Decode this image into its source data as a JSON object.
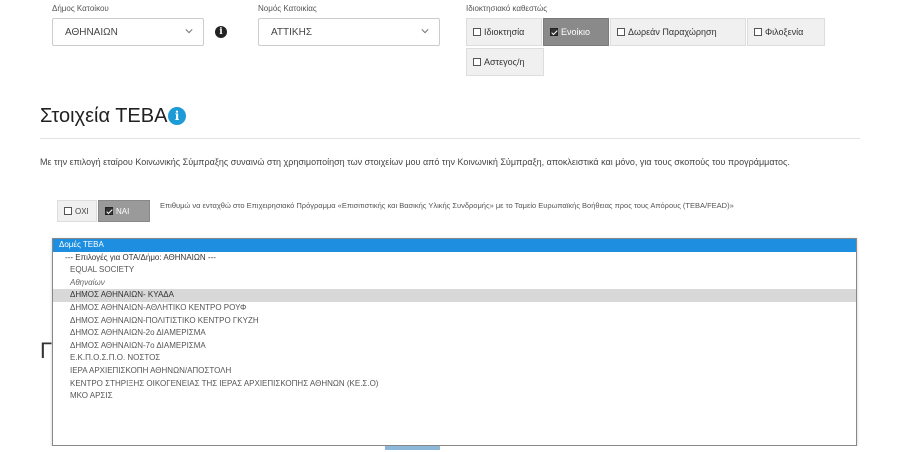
{
  "filters": {
    "municipality_label": "Δήμος Κατοίκου",
    "municipality_value": "ΑΘΗΝΑΙΩΝ",
    "region_label": "Νομός Κατοικίας",
    "region_value": "ΑΤΤΙΚΗΣ",
    "status_label": "Ιδιοκτησιακό καθεστώς",
    "status_options": [
      {
        "label": "Ιδιοκτησία",
        "checked": false
      },
      {
        "label": "Ενοίκιο",
        "checked": true
      },
      {
        "label": "Δωρεάν Παραχώρηση",
        "checked": false
      },
      {
        "label": "Φιλοξενία",
        "checked": false
      },
      {
        "label": "Αστεγος/η",
        "checked": false
      }
    ]
  },
  "teba": {
    "title": "Στοιχεία ΤΕΒΑ",
    "description": "Με την επιλογή εταίρου Κοινωνικής Σύμπραξης συναινώ στη χρησιμοποίηση των στοιχείων μου από την Κοινωνική Σύμπραξη, αποκλειστικά και μόνο, για τους σκοπούς του προγράμματος.",
    "toggle_no": "ΟΧΙ",
    "toggle_yes": "ΝΑΙ",
    "note": "Επιθυμώ να ενταχθώ στο Επιχειρησιακό Πρόγραμμα «Επισιτιστικής και Βασικής Υλικής Συνδρομής» με το Ταμείο Ευρωπαϊκής Βοήθειας προς τους Απόρους (ΤΕΒΑ/FEAD)»"
  },
  "background": {
    "partial_letter": "Γ"
  },
  "dropdown": {
    "items": [
      {
        "text": "Δομές ΤΕΒΑ",
        "kind": "selected"
      },
      {
        "text": "--- Επιλογές για ΟΤΑ/Δήμο: ΑΘΗΝΑΙΩΝ ---",
        "kind": "group"
      },
      {
        "text": "EQUAL SOCIETY",
        "kind": "normal"
      },
      {
        "text": "Αθηναίων",
        "kind": "italic"
      },
      {
        "text": "ΔΗΜΟΣ ΑΘΗΝΑΙΩΝ- ΚΥΑΔΑ",
        "kind": "hover"
      },
      {
        "text": "ΔΗΜΟΣ ΑΘΗΝΑΙΩΝ-ΑΘΛΗΤΙΚΟ ΚΕΝΤΡΟ ΡΟΥΦ",
        "kind": "normal"
      },
      {
        "text": "ΔΗΜΟΣ ΑΘΗΝΑΙΩΝ-ΠΟΛΙΤΙΣΤΙΚΟ ΚΕΝΤΡΟ ΓΚΥΖΗ",
        "kind": "normal"
      },
      {
        "text": "ΔΗΜΟΣ ΑΘΗΝΑΙΩΝ-2ο ΔΙΑΜΕΡΙΣΜΑ",
        "kind": "normal"
      },
      {
        "text": "ΔΗΜΟΣ ΑΘΗΝΑΙΩΝ-7ο ΔΙΑΜΕΡΙΣΜΑ",
        "kind": "normal"
      },
      {
        "text": "Ε.Κ.Π.Ο.Σ.Π.Ο. ΝΟΣΤΟΣ",
        "kind": "normal"
      },
      {
        "text": "ΙΕΡΑ ΑΡΧΙΕΠΙΣΚΟΠΗ ΑΘΗΝΩΝ/ΑΠΟΣΤΟΛΗ",
        "kind": "normal"
      },
      {
        "text": "ΚΕΝΤΡΟ ΣΤΗΡΙΞΗΣ ΟΙΚΟΓΕΝΕΙΑΣ ΤΗΣ ΙΕΡΑΣ ΑΡΧΙΕΠΙΣΚΟΠΗΣ ΑΘΗΝΩΝ (ΚΕ.Σ.Ο)",
        "kind": "normal"
      },
      {
        "text": "ΜΚΟ ΑΡΣΙΣ",
        "kind": "normal"
      }
    ]
  },
  "colors": {
    "accent": "#1e8fe0",
    "info_blue": "#1e9bd7",
    "active_gray": "#8a8a8a"
  }
}
